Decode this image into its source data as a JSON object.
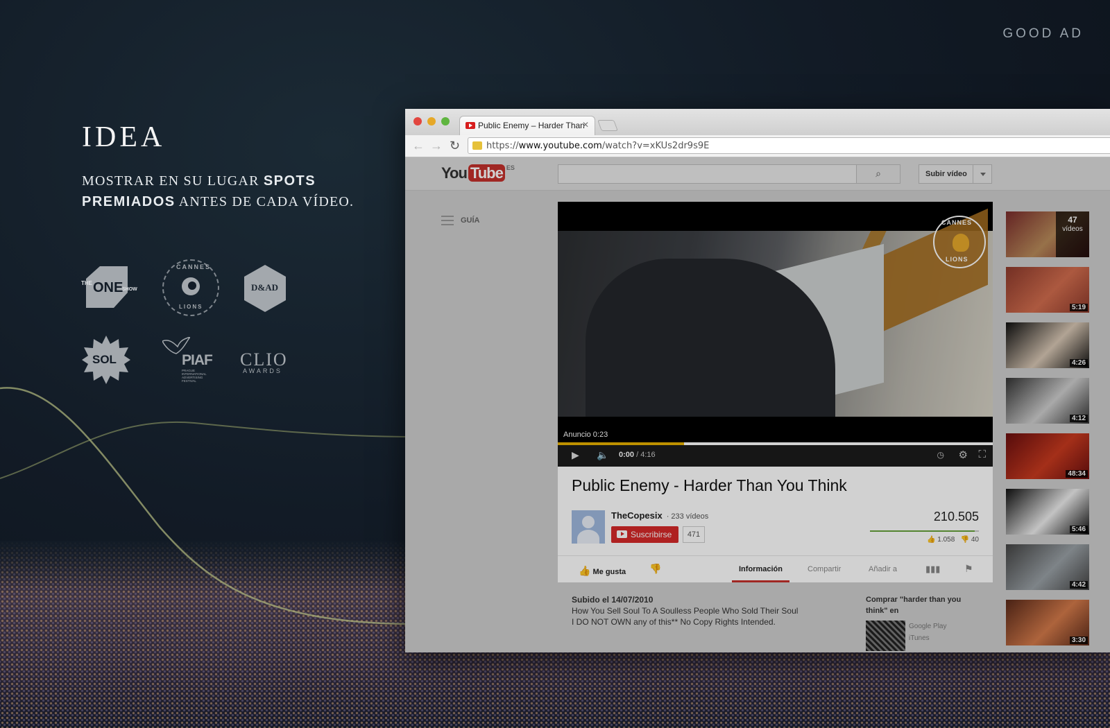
{
  "brand": "GOOD AD",
  "idea": {
    "title": "IDEA",
    "line1_pre": "MOSTRAR EN SU LUGAR ",
    "line1_bold": "SPOTS",
    "line2_bold": "PREMIADOS",
    "line2_post": " ANTES DE CADA VÍDEO."
  },
  "awards": {
    "one_show_the": "THE",
    "one_show_one": "ONE",
    "one_show_show": "SHOW",
    "cannes_top": "CANNES",
    "cannes_side": "LIONS",
    "dad": "D&AD",
    "sol": "SOL",
    "piaf": "PIAF",
    "piaf_sub": "PRAGUE INTERNATIONAL ADVERTISING FESTIVAL",
    "clio": "CLIO",
    "clio_sub": "AWARDS"
  },
  "browser": {
    "tab_title": "Public Enemy – Harder Than",
    "url_scheme": "https://",
    "url_domain": "www.youtube.com",
    "url_path": "/watch?v=xKUs2dr9s9E",
    "traffic_lights": [
      "#e2463f",
      "#e6a828",
      "#5fb53f"
    ]
  },
  "youtube": {
    "logo_you": "You",
    "logo_tube": "Tube",
    "logo_region": "ES",
    "upload_label": "Subir vídeo",
    "guide_label": "GUÍA",
    "player": {
      "badge_top": "CANNES",
      "badge_bottom": "LIONS",
      "ad_label": "Anuncio 0:23",
      "time_current": "0:00",
      "time_total": " / 4:16",
      "ad_progress": 0.29
    },
    "video_title": "Public Enemy - Harder Than You Think",
    "channel_name": "TheCopesix",
    "channel_videos": "· 233 vídeos",
    "subscribe_label": "Suscribirse",
    "subscriber_count": "471",
    "views": "210.505",
    "likes": "1.058",
    "dislikes": "40",
    "like_ratio": 0.96,
    "actions": {
      "like": "Me gusta",
      "info": "Información",
      "share": "Compartir",
      "add_to": "Añadir a"
    },
    "description": {
      "uploaded": "Subido el 14/07/2010",
      "line1": "How You Sell Soul To A Soulless People Who Sold Their Soul",
      "line2": "I DO NOT OWN any of this** No Copy Rights Intended."
    },
    "buy": {
      "title": "Comprar \"harder than you think\" en",
      "store1": "Google Play",
      "store2": "iTunes"
    },
    "related": [
      {
        "duration": "",
        "playlist_count": "47",
        "playlist_label": "vídeos",
        "colors": [
          "#7a2c2c",
          "#b98b5a"
        ]
      },
      {
        "duration": "5:19",
        "colors": [
          "#8d3a2c",
          "#d26d4e"
        ]
      },
      {
        "duration": "4:26",
        "colors": [
          "#101010",
          "#d9c8b5"
        ]
      },
      {
        "duration": "4:12",
        "colors": [
          "#333",
          "#cfcfcf"
        ]
      },
      {
        "duration": "48:34",
        "colors": [
          "#6a0f0f",
          "#c83a1f"
        ]
      },
      {
        "duration": "5:46",
        "colors": [
          "#111",
          "#eee"
        ]
      },
      {
        "duration": "4:42",
        "colors": [
          "#444",
          "#9aa1a6"
        ]
      },
      {
        "duration": "3:30",
        "colors": [
          "#5a2a1a",
          "#d47a4a"
        ]
      }
    ]
  }
}
